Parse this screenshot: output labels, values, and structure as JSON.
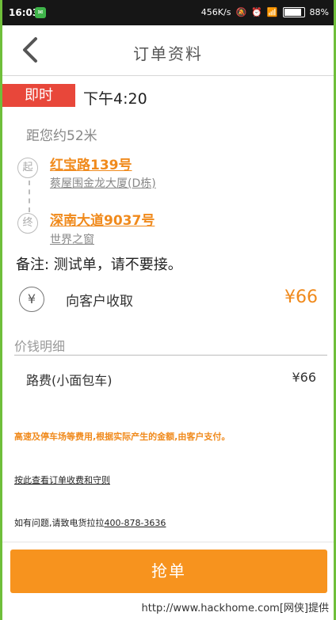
{
  "status_bar": {
    "time": "16:03",
    "net_speed": "456K/s",
    "battery_percent": "88%",
    "icons": [
      "app-notification-icon",
      "mute-icon",
      "alarm-icon",
      "wifi-icon",
      "signal-icon",
      "battery-icon"
    ]
  },
  "header": {
    "title": "订单资料",
    "back_icon": "chevron-left-icon"
  },
  "order": {
    "badge": "即时",
    "time": "下午4:20",
    "distance": "距您约52米",
    "start": {
      "marker": "起",
      "main": "红宝路139号",
      "sub": "蔡屋围金龙大厦(D栋)"
    },
    "end": {
      "marker": "终",
      "main": "深南大道9037号",
      "sub": "世界之窗"
    },
    "remark": "备注: 测试单，请不要接。",
    "collect_icon": "¥",
    "collect_label": "向客户收取",
    "amount": "¥66"
  },
  "price": {
    "section_title": "价钱明细",
    "fee_label": "路费(小面包车)",
    "fee_value": "¥66",
    "note": "高速及停车场等费用,根据实际产生的金额,由客户支付。",
    "rules_link": "按此查看订单收费和守则",
    "contact_prefix": "如有问题,请致电货拉拉",
    "contact_phone": "400-878-3636"
  },
  "action": {
    "grab_label": "抢单"
  },
  "watermark": "http://www.hackhome.com[网侠]提供",
  "colors": {
    "accent": "#f7931e",
    "badge": "#e8473a",
    "border_green": "#6fbf3a"
  }
}
